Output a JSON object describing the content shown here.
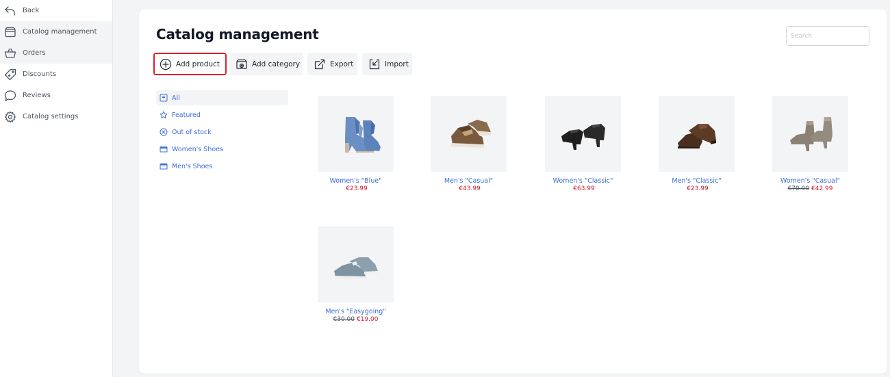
{
  "sidebar": {
    "items": [
      {
        "label": "Back",
        "icon": "back-arrow-icon",
        "active": false
      },
      {
        "label": "Catalog management",
        "icon": "box-icon",
        "active": true
      },
      {
        "label": "Orders",
        "icon": "basket-icon",
        "active": true
      },
      {
        "label": "Discounts",
        "icon": "tag-icon",
        "active": false
      },
      {
        "label": "Reviews",
        "icon": "speech-bubble-icon",
        "active": false
      },
      {
        "label": "Catalog settings",
        "icon": "gear-icon",
        "active": false
      }
    ]
  },
  "main": {
    "title": "Catalog management",
    "search": {
      "placeholder": "Search",
      "value": ""
    },
    "toolbar": [
      {
        "label": "Add product",
        "icon": "plus-circle-icon",
        "highlighted": true
      },
      {
        "label": "Add category",
        "icon": "add-category-icon",
        "highlighted": false
      },
      {
        "label": "Export",
        "icon": "export-icon",
        "highlighted": false
      },
      {
        "label": "Import",
        "icon": "import-icon",
        "highlighted": false
      }
    ],
    "categories": [
      {
        "label": "All",
        "icon": "all-icon",
        "active": true
      },
      {
        "label": "Featured",
        "icon": "star-icon",
        "active": false
      },
      {
        "label": "Out of stock",
        "icon": "x-circle-icon",
        "active": false
      },
      {
        "label": "Women's Shoes",
        "icon": "folder-icon",
        "active": false
      },
      {
        "label": "Men's Shoes",
        "icon": "folder-icon",
        "active": false
      }
    ],
    "products": [
      {
        "name": "Women's \"Blue\"",
        "old_price": "",
        "price": "€23.99",
        "image": "blue-fringe-ankle-boots"
      },
      {
        "name": "Men's \"Casual\"",
        "old_price": "",
        "price": "€43.99",
        "image": "brown-sneakers"
      },
      {
        "name": "Women's \"Classic\"",
        "old_price": "",
        "price": "€63.99",
        "image": "black-heeled-booties"
      },
      {
        "name": "Men's \"Classic\"",
        "old_price": "",
        "price": "€23.99",
        "image": "brown-oxford-shoes"
      },
      {
        "name": "Women's \"Casual\"",
        "old_price": "€70.00",
        "price": "€42.99",
        "image": "grey-lace-up-heeled-boots"
      },
      {
        "name": "Men's \"Easygoing\"",
        "old_price": "€30.00",
        "price": "€19.00",
        "image": "grey-canvas-sneakers"
      }
    ]
  },
  "colors": {
    "accent_link": "#3b6fd4",
    "price": "#d11a2a",
    "highlight_outline": "#e11d2a",
    "background": "#f3f4f6"
  }
}
